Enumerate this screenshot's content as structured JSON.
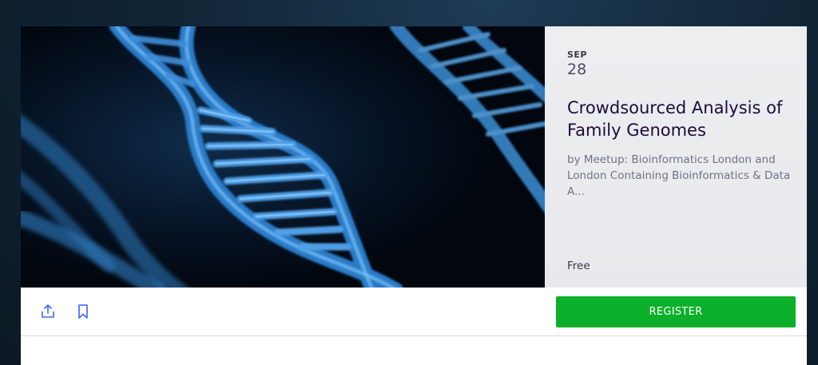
{
  "event": {
    "month": "SEP",
    "day": "28",
    "title": "Crowdsourced Analysis of Family Genomes",
    "organizer": "by Meetup: Bioinformatics London and London Containing Bioinformatics & Data A...",
    "price": "Free"
  },
  "hero_image": {
    "subject": "dna-double-helix-image"
  },
  "actions": {
    "share_icon": "share-icon",
    "save_icon": "bookmark-icon",
    "register_label": "REGISTER"
  },
  "colors": {
    "accent": "#0db02b",
    "icon": "#3d64ff",
    "title": "#1e0a3c"
  }
}
